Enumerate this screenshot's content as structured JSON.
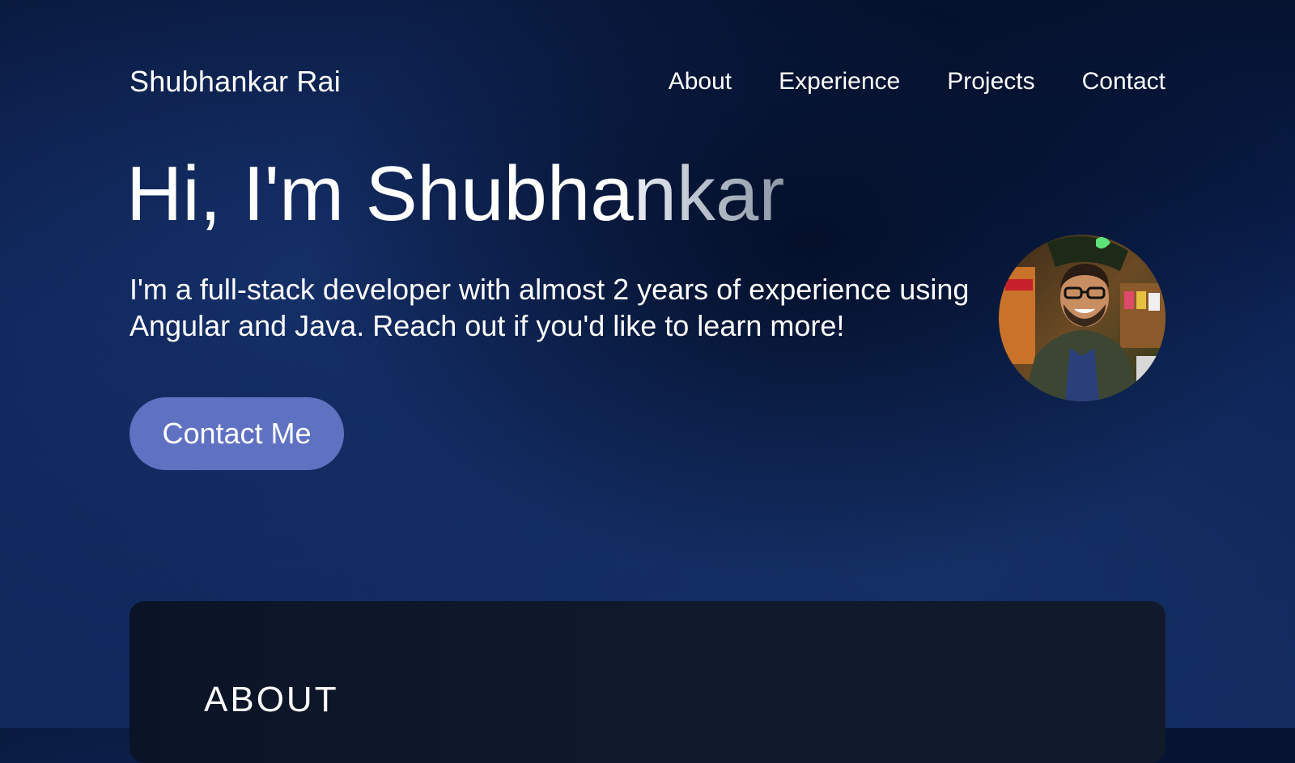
{
  "nav": {
    "brand": "Shubhankar Rai",
    "links": [
      "About",
      "Experience",
      "Projects",
      "Contact"
    ]
  },
  "hero": {
    "title_part1": "Hi, I'm Shubha",
    "title_part2": "nkar",
    "description": "I'm a full-stack developer with almost 2 years of experience using Angular and Java. Reach out if you'd like to learn more!",
    "cta_label": "Contact Me"
  },
  "about": {
    "heading": "ABOUT"
  },
  "colors": {
    "background": "#0b2152",
    "cta": "#5f72c2",
    "card": "#0e1729"
  }
}
